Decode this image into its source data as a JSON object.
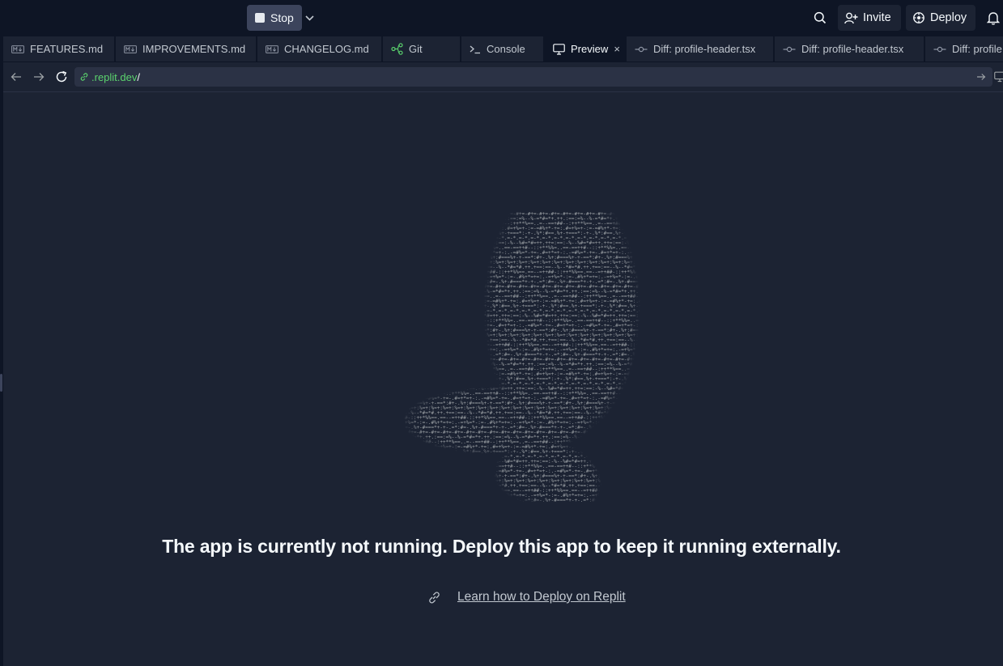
{
  "topbar": {
    "stop_label": "Stop",
    "invite_label": "Invite",
    "deploy_label": "Deploy"
  },
  "tabs": [
    {
      "label": "FEATURES.md",
      "icon": "markdown-icon"
    },
    {
      "label": "IMPROVEMENTS.md",
      "icon": "markdown-icon"
    },
    {
      "label": "CHANGELOG.md",
      "icon": "markdown-icon"
    },
    {
      "label": "Git",
      "icon": "git-icon"
    },
    {
      "label": "Console",
      "icon": "terminal-icon"
    },
    {
      "label": "Preview",
      "icon": "monitor-icon",
      "active": true,
      "close": "×"
    },
    {
      "label": "Diff: profile-header.tsx",
      "icon": "commit-icon"
    },
    {
      "label": "Diff: profile-header.tsx",
      "icon": "commit-icon"
    },
    {
      "label": "Diff: profile",
      "icon": "commit-icon"
    }
  ],
  "address": {
    "host": ".replit.dev",
    "path": "/"
  },
  "preview": {
    "message": "The app is currently not running. Deploy this app to keep it running externally.",
    "link_label": "Learn how to Deploy on Replit"
  },
  "colors": {
    "background": "#0e1525",
    "surface": "#1c2333",
    "url_host": "#5bd36d",
    "ascii_art": "#9da2a6"
  }
}
